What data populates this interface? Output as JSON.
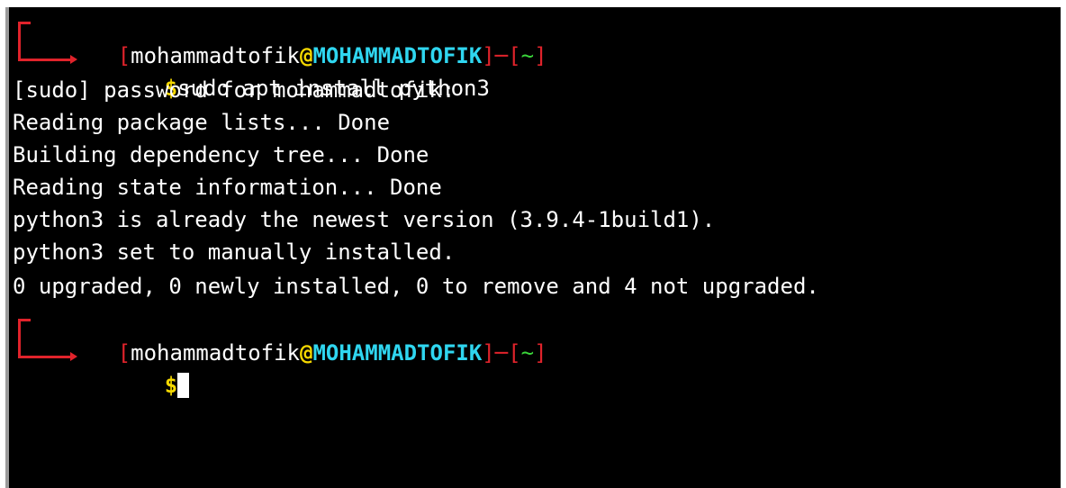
{
  "prompt1": {
    "open_bracket": "[",
    "user": "mohammadtofik",
    "at": "@",
    "host": "MOHAMMADTOFIK",
    "mid": "]─[",
    "cwd": "~",
    "close_bracket": "]",
    "dollar": "$",
    "command": "sudo apt install python3"
  },
  "output": [
    "[sudo] password for mohammadtofik:",
    "Reading package lists... Done",
    "Building dependency tree... Done",
    "Reading state information... Done",
    "python3 is already the newest version (3.9.4-1build1).",
    "python3 set to manually installed.",
    "0 upgraded, 0 newly installed, 0 to remove and 4 not upgraded."
  ],
  "prompt2": {
    "open_bracket": "[",
    "user": "mohammadtofik",
    "at": "@",
    "host": "MOHAMMADTOFIK",
    "mid": "]─[",
    "cwd": "~",
    "close_bracket": "]",
    "dollar": "$",
    "command": ""
  },
  "colors": {
    "background": "#000000",
    "text": "#ffffff",
    "bracket": "#e0232b",
    "at_sign": "#f5d800",
    "hostname": "#2fd6f0",
    "cwd": "#3ad63a",
    "dollar": "#f5d800"
  }
}
